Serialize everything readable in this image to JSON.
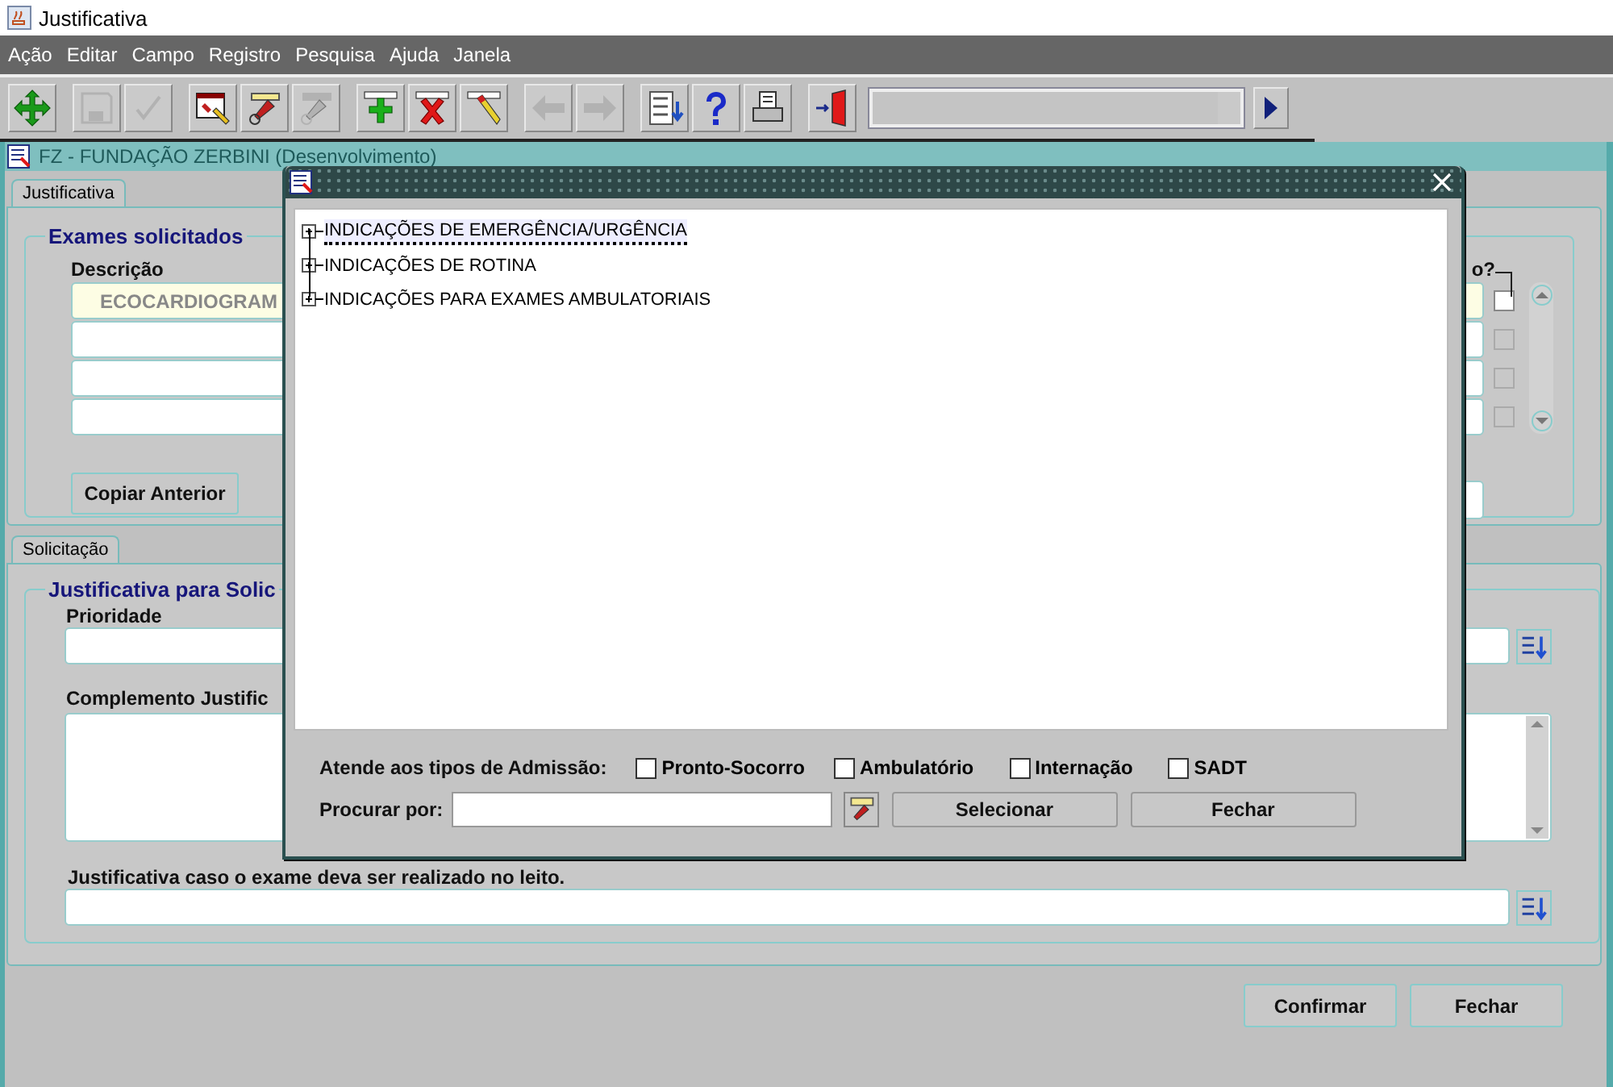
{
  "window": {
    "title": "Justificativa"
  },
  "menu": [
    "Ação",
    "Editar",
    "Campo",
    "Registro",
    "Pesquisa",
    "Ajuda",
    "Janela"
  ],
  "toolbar": [
    {
      "kind": "move",
      "disabled": false
    },
    {
      "kind": "save",
      "disabled": true
    },
    {
      "kind": "check",
      "disabled": true
    },
    {
      "kind": "window-edit",
      "disabled": false
    },
    {
      "kind": "torch",
      "disabled": false
    },
    {
      "kind": "torch-down",
      "disabled": true
    },
    {
      "kind": "add",
      "disabled": false
    },
    {
      "kind": "delete",
      "disabled": false
    },
    {
      "kind": "pencil",
      "disabled": false
    },
    {
      "kind": "arrow-left",
      "disabled": true
    },
    {
      "kind": "arrow-right",
      "disabled": true
    },
    {
      "kind": "list",
      "disabled": false
    },
    {
      "kind": "help",
      "disabled": false
    },
    {
      "kind": "print",
      "disabled": false
    },
    {
      "kind": "exit",
      "disabled": false
    }
  ],
  "form_window": {
    "title": "FZ - FUNDAÇÃO ZERBINI (Desenvolvimento)"
  },
  "top_tab": {
    "label": "Justificativa"
  },
  "exames": {
    "legend": "Exames solicitados",
    "column_1": "Descrição",
    "column_2": "o?",
    "rows": [
      {
        "description": "ECOCARDIOGRAM",
        "current": true,
        "checked": false,
        "disabled": false
      },
      {
        "current": false,
        "checked": false,
        "disabled": true
      },
      {
        "current": false,
        "checked": false,
        "disabled": true
      },
      {
        "current": false,
        "checked": false,
        "disabled": true
      }
    ],
    "copy_button": "Copiar Anterior"
  },
  "bottom_tab": {
    "label": "Solicitação"
  },
  "solicitacao": {
    "legend": "Justificativa para Solic",
    "priority_label": "Prioridade",
    "complement_label": "Complemento Justific",
    "bed_label": "Justificativa caso o exame deva ser realizado no leito."
  },
  "buttons": [
    "Confirmar",
    "Fechar"
  ],
  "dialog": {
    "tree": [
      {
        "label": "INDICAÇÕES DE EMERGÊNCIA/URGÊNCIA",
        "expanded": false,
        "selected": true
      },
      {
        "label": "INDICAÇÕES DE ROTINA",
        "expanded": false,
        "selected": false
      },
      {
        "label": "INDICAÇÕES PARA EXAMES AMBULATORIAIS",
        "expanded": false,
        "selected": false
      }
    ],
    "admission_label": "Atende aos tipos de Admissão:",
    "admission_types": [
      {
        "label": "Pronto-Socorro",
        "checked": false
      },
      {
        "label": "Ambulatório",
        "checked": false
      },
      {
        "label": "Internação",
        "checked": false
      },
      {
        "label": "SADT",
        "checked": false
      }
    ],
    "search_label": "Procurar por:",
    "buttons": [
      "Selecionar",
      "Fechar"
    ]
  }
}
